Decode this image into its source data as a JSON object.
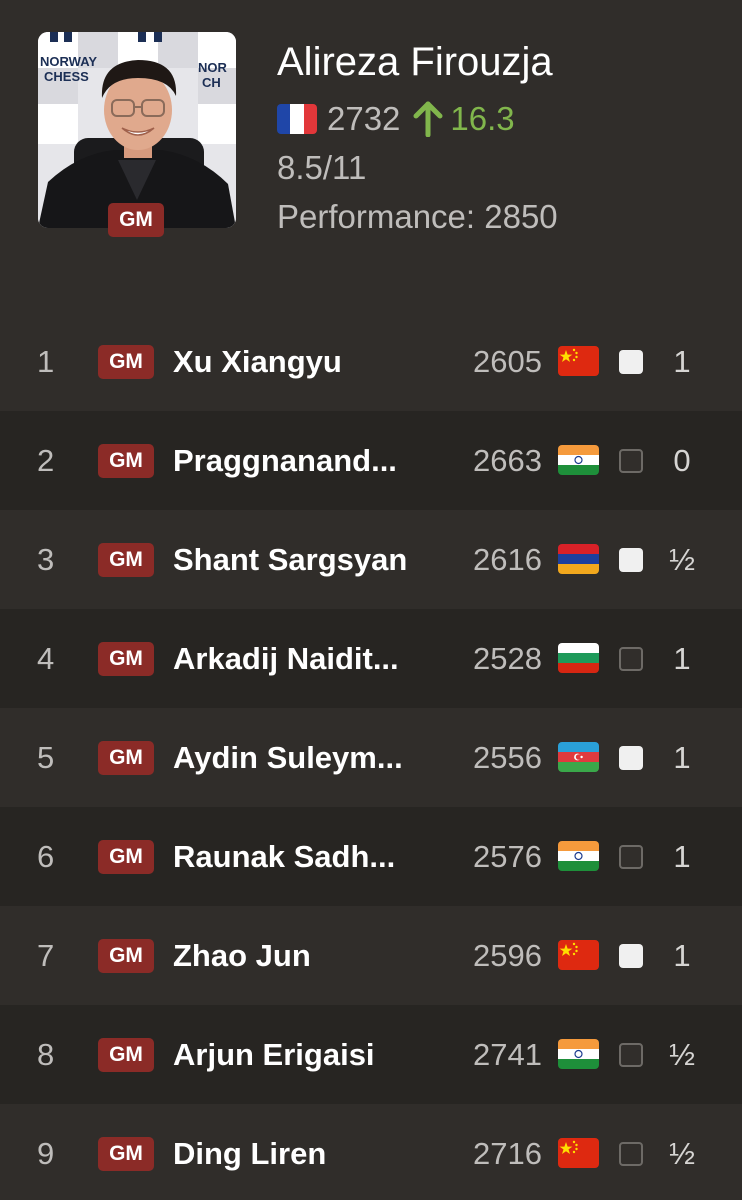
{
  "player": {
    "name": "Alireza Firouzja",
    "title": "GM",
    "rating": "2732",
    "rating_change": "16.3",
    "rating_change_icon": "arrow-up-icon",
    "score": "8.5/11",
    "performance": "Performance: 2850",
    "flag": "france",
    "photo_text_left": "NORWAY CHESS",
    "photo_text_right": "NORWAY CHESS"
  },
  "colors": {
    "title_badge": "#8b2b27",
    "positive_change": "#81b64c",
    "background": "#302d2a",
    "alt_row": "#272522"
  },
  "games": [
    {
      "round": "1",
      "title": "GM",
      "name": "Xu Xiangyu",
      "rating": "2605",
      "flag": "china",
      "color": "white",
      "result": "1"
    },
    {
      "round": "2",
      "title": "GM",
      "name": "Praggnanand...",
      "rating": "2663",
      "flag": "india",
      "color": "black",
      "result": "0"
    },
    {
      "round": "3",
      "title": "GM",
      "name": "Shant Sargsyan",
      "rating": "2616",
      "flag": "armenia",
      "color": "white",
      "result": "½"
    },
    {
      "round": "4",
      "title": "GM",
      "name": "Arkadij Naidit...",
      "rating": "2528",
      "flag": "bulgaria",
      "color": "black",
      "result": "1"
    },
    {
      "round": "5",
      "title": "GM",
      "name": "Aydin Suleym...",
      "rating": "2556",
      "flag": "azerbaijan",
      "color": "white",
      "result": "1"
    },
    {
      "round": "6",
      "title": "GM",
      "name": "Raunak Sadh...",
      "rating": "2576",
      "flag": "india",
      "color": "black",
      "result": "1"
    },
    {
      "round": "7",
      "title": "GM",
      "name": "Zhao Jun",
      "rating": "2596",
      "flag": "china",
      "color": "white",
      "result": "1"
    },
    {
      "round": "8",
      "title": "GM",
      "name": "Arjun Erigaisi",
      "rating": "2741",
      "flag": "india",
      "color": "black",
      "result": "½"
    },
    {
      "round": "9",
      "title": "GM",
      "name": "Ding Liren",
      "rating": "2716",
      "flag": "china",
      "color": "black",
      "result": "½"
    }
  ]
}
